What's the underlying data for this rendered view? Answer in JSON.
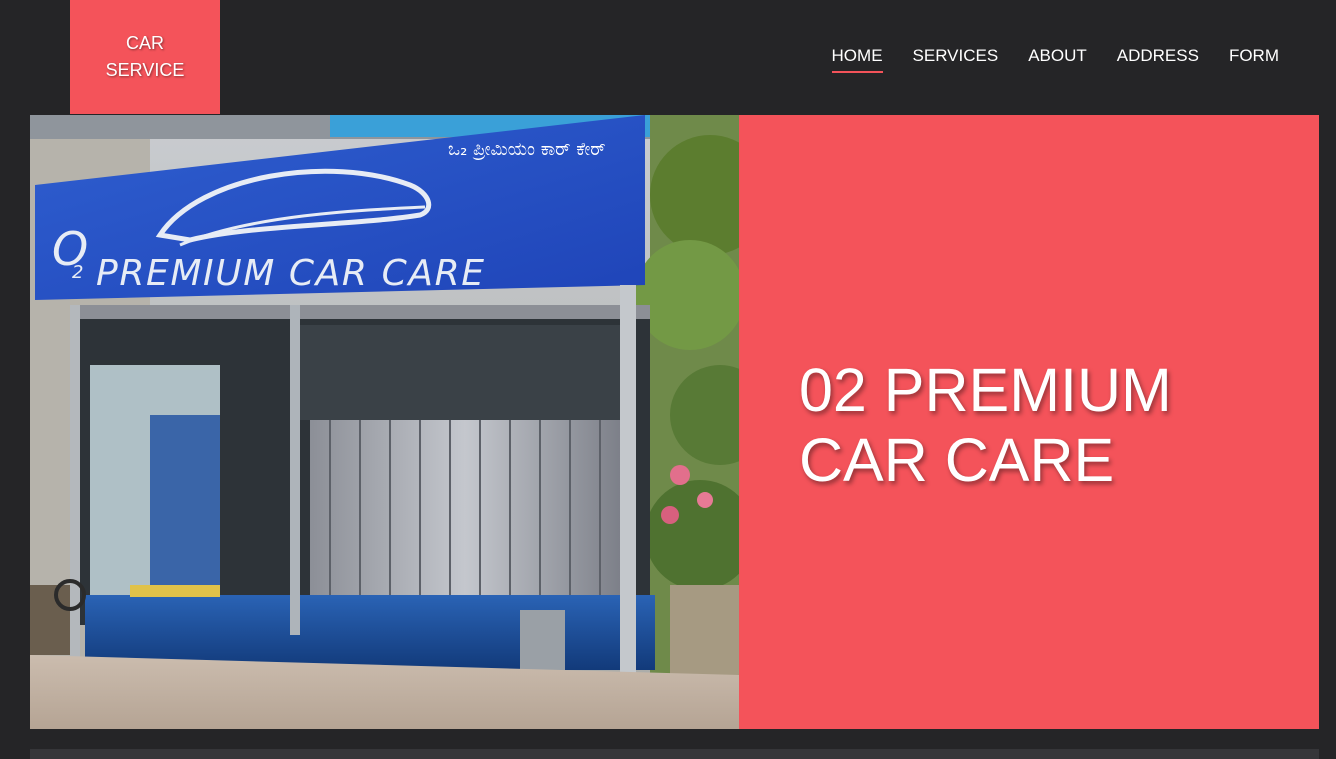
{
  "brand": {
    "line1": "CAR",
    "line2": "SERVICE"
  },
  "nav": {
    "items": [
      "HOME",
      "SERVICES",
      "ABOUT",
      "ADDRESS",
      "FORM"
    ],
    "active": "HOME"
  },
  "hero": {
    "title_line1": "02 PREMIUM",
    "title_line2": "CAR CARE",
    "photo_sign_text": "O2 PREMIUM CAR CARE",
    "photo_sign_kannada": "ಒ₂ ಪ್ರೀಮಿಯಂ ಕಾರ್ ಕೇರ್"
  },
  "colors": {
    "accent": "#f4535a",
    "background": "#252527"
  }
}
